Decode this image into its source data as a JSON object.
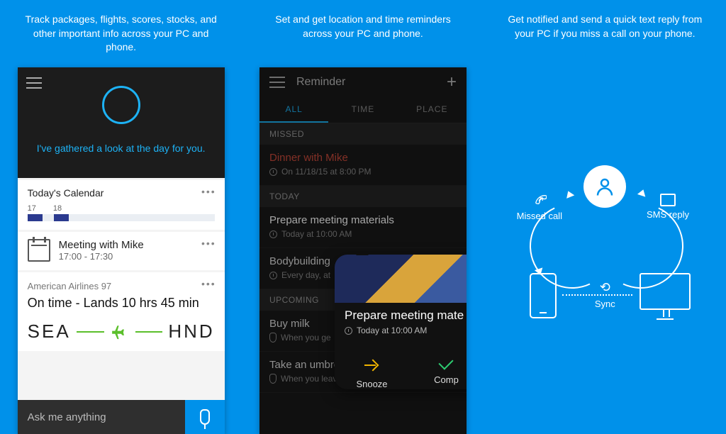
{
  "captions": {
    "panel1": "Track packages, flights, scores, stocks, and other important info across your PC and phone.",
    "panel2": "Set and get location and time reminders across your PC and phone.",
    "panel3": "Get notified and send a quick text reply from your PC if you miss a call on your phone."
  },
  "cortana": {
    "subtitle": "I've gathered a look at the day for you.",
    "calendar_card_title": "Today's Calendar",
    "calendar_nums": {
      "a": "17",
      "b": "18"
    },
    "meeting": {
      "title": "Meeting with Mike",
      "time": "17:00 - 17:30"
    },
    "flight": {
      "carrier": "American Airlines 97",
      "status": "On time - Lands 10 hrs 45 min",
      "from": "SEA",
      "to": "HND"
    },
    "ask_placeholder": "Ask me anything"
  },
  "reminders": {
    "title": "Reminder",
    "tabs": {
      "all": "ALL",
      "time": "TIME",
      "place": "PLACE"
    },
    "sections": {
      "missed": "MISSED",
      "today": "TODAY",
      "upcoming": "UPCOMING"
    },
    "items": {
      "missed1": {
        "title": "Dinner with Mike",
        "sub": "On 11/18/15 at 8:00 PM"
      },
      "today1": {
        "title": "Prepare meeting materials",
        "sub": "Today at 10:00 AM"
      },
      "today2": {
        "title": "Bodybuilding",
        "sub": "Every day, at"
      },
      "up1": {
        "title": "Buy milk",
        "sub": "When you ge"
      },
      "up2": {
        "title": "Take an umbre",
        "sub": "When you leave home"
      }
    },
    "notif": {
      "title": "Prepare meeting mate",
      "sub": "Today at 10:00 AM",
      "snooze": "Snooze",
      "complete": "Comp"
    }
  },
  "diagram": {
    "missed": "Missed call",
    "sms": "SMS reply",
    "sync": "Sync"
  }
}
